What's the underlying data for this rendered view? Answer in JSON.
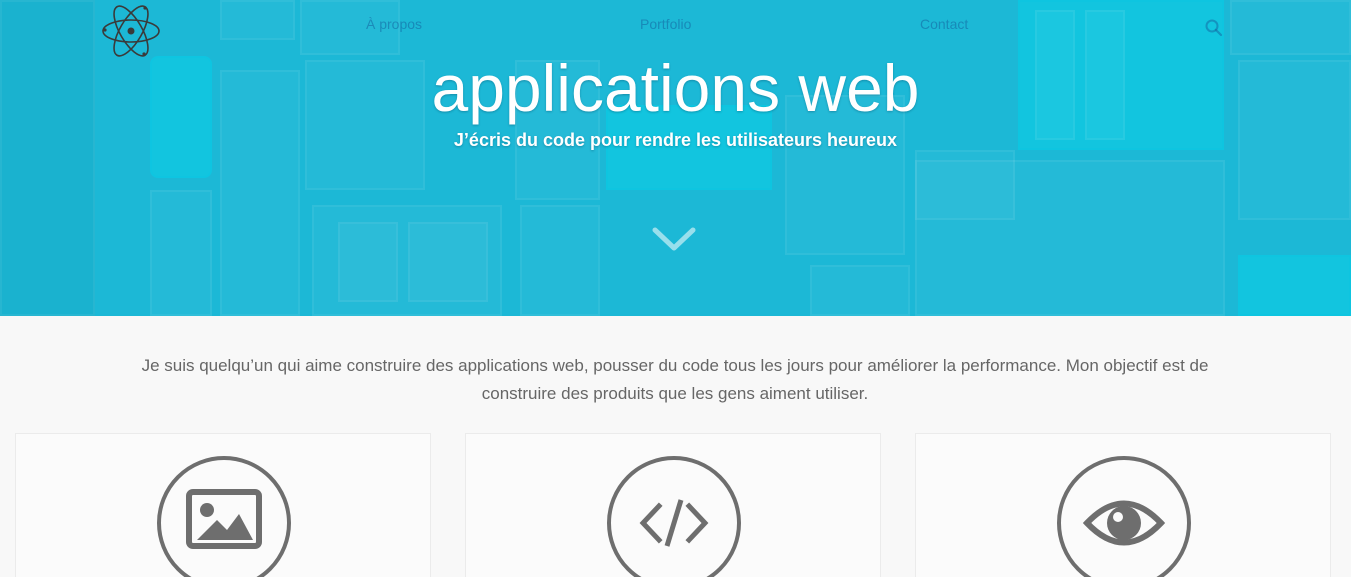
{
  "nav": {
    "items": [
      {
        "label": "À propos"
      },
      {
        "label": "Portfolio"
      },
      {
        "label": "Contact"
      }
    ]
  },
  "hero": {
    "title": "applications web",
    "subtitle": "J’écris du code pour rendre les utilisateurs heureux"
  },
  "intro": {
    "text": "Je suis quelqu’un qui aime construire des applications web, pousser du code tous les jours pour améliorer la performance. Mon objectif est de construire des produits que les gens aiment utiliser."
  },
  "cards": [
    {
      "icon": "image-icon"
    },
    {
      "icon": "code-icon"
    },
    {
      "icon": "eye-icon"
    }
  ],
  "colors": {
    "hero_bg": "#1cb8d6",
    "icon_stroke": "#6e6e6e",
    "body_text": "#666666",
    "page_bg": "#f8f8f8"
  }
}
